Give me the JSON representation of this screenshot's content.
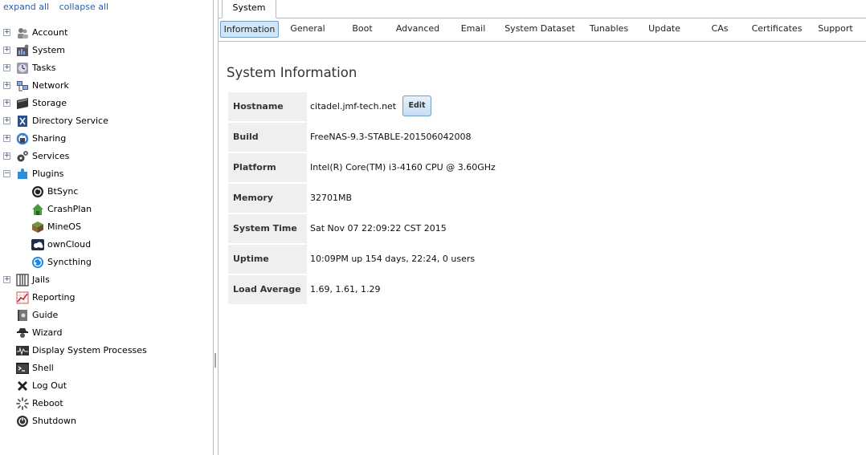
{
  "sidebar": {
    "expand_all": "expand all",
    "collapse_all": "collapse all",
    "items": [
      {
        "label": "Account",
        "icon": "account-icon",
        "expander": "+"
      },
      {
        "label": "System",
        "icon": "system-icon",
        "expander": "+"
      },
      {
        "label": "Tasks",
        "icon": "tasks-icon",
        "expander": "+"
      },
      {
        "label": "Network",
        "icon": "network-icon",
        "expander": "+"
      },
      {
        "label": "Storage",
        "icon": "storage-icon",
        "expander": "+"
      },
      {
        "label": "Directory Service",
        "icon": "directory-service-icon",
        "expander": "+"
      },
      {
        "label": "Sharing",
        "icon": "sharing-icon",
        "expander": "+"
      },
      {
        "label": "Services",
        "icon": "services-icon",
        "expander": "+"
      },
      {
        "label": "Plugins",
        "icon": "plugins-icon",
        "expander": "−"
      },
      {
        "label": "BtSync",
        "icon": "btsync-icon",
        "child": true
      },
      {
        "label": "CrashPlan",
        "icon": "crashplan-icon",
        "child": true
      },
      {
        "label": "MineOS",
        "icon": "mineos-icon",
        "child": true
      },
      {
        "label": "ownCloud",
        "icon": "owncloud-icon",
        "child": true
      },
      {
        "label": "Syncthing",
        "icon": "syncthing-icon",
        "child": true
      },
      {
        "label": "Jails",
        "icon": "jails-icon",
        "expander": "+"
      },
      {
        "label": "Reporting",
        "icon": "reporting-icon"
      },
      {
        "label": "Guide",
        "icon": "guide-icon"
      },
      {
        "label": "Wizard",
        "icon": "wizard-icon"
      },
      {
        "label": "Display System Processes",
        "icon": "processes-icon"
      },
      {
        "label": "Shell",
        "icon": "shell-icon"
      },
      {
        "label": "Log Out",
        "icon": "logout-icon"
      },
      {
        "label": "Reboot",
        "icon": "reboot-icon"
      },
      {
        "label": "Shutdown",
        "icon": "shutdown-icon"
      }
    ]
  },
  "main": {
    "outer_tab": "System",
    "tabs": [
      {
        "label": "Information",
        "active": true
      },
      {
        "label": "General"
      },
      {
        "label": "Boot"
      },
      {
        "label": "Advanced"
      },
      {
        "label": "Email"
      },
      {
        "label": "System Dataset"
      },
      {
        "label": "Tunables"
      },
      {
        "label": "Update"
      },
      {
        "label": "CAs"
      },
      {
        "label": "Certificates"
      },
      {
        "label": "Support"
      }
    ],
    "section_title": "System Information",
    "edit_label": "Edit",
    "info": [
      {
        "label": "Hostname",
        "value": "citadel.jmf-tech.net"
      },
      {
        "label": "Build",
        "value": "FreeNAS-9.3-STABLE-201506042008"
      },
      {
        "label": "Platform",
        "value": "Intel(R) Core(TM) i3-4160 CPU @ 3.60GHz"
      },
      {
        "label": "Memory",
        "value": "32701MB"
      },
      {
        "label": "System Time",
        "value": "Sat Nov 07 22:09:22 CST 2015"
      },
      {
        "label": "Uptime",
        "value": "10:09PM up 154 days, 22:24, 0 users"
      },
      {
        "label": "Load Average",
        "value": "1.69, 1.61, 1.29"
      }
    ]
  },
  "colors": {
    "link": "#2a5db0",
    "active_tab_bg": "#cfe5fa",
    "label_bg": "#efefef",
    "border": "#b5bcc7"
  }
}
